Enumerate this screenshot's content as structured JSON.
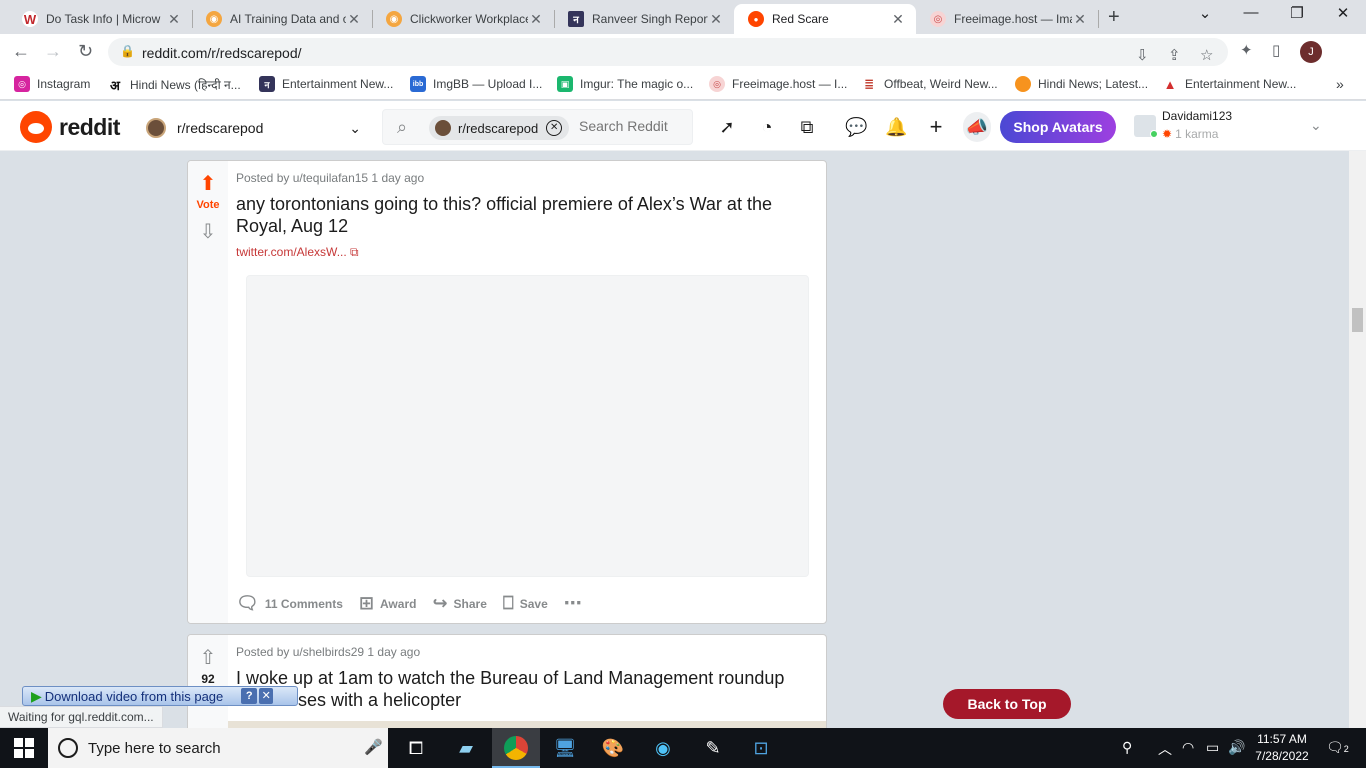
{
  "browser": {
    "tabs": [
      {
        "title": "Do Task Info | Microw",
        "fav": "W",
        "favbg": "#ffffff",
        "favfg": "#c2282d"
      },
      {
        "title": "AI Training Data and o",
        "fav": "◉",
        "favbg": "#f4a640",
        "favfg": "#ffffff"
      },
      {
        "title": "Clickworker Workplace",
        "fav": "◉",
        "favbg": "#f4a640",
        "favfg": "#ffffff"
      },
      {
        "title": "Ranveer Singh Report",
        "fav": "न",
        "favbg": "#34345a",
        "favfg": "#ffffff"
      },
      {
        "title": "Red Scare",
        "fav": "●",
        "favbg": "#ff4500",
        "favfg": "#ffffff"
      },
      {
        "title": "Freeimage.host — Ima",
        "fav": "◎",
        "favbg": "#f7d4d4",
        "favfg": "#c94a4a"
      }
    ],
    "url": "reddit.com/r/redscarepod/",
    "bookmarks": [
      {
        "label": "Instagram",
        "bg": "#d6249f",
        "icon": "◎"
      },
      {
        "label": "Hindi News (हिन्दी न...",
        "bg": "#ffffff",
        "icon": "अ"
      },
      {
        "label": "Entertainment New...",
        "bg": "#34345a",
        "icon": "न"
      },
      {
        "label": "ImgBB — Upload I...",
        "bg": "#2a6ad4",
        "icon": "ibb"
      },
      {
        "label": "Imgur: The magic o...",
        "bg": "#1bb76e",
        "icon": "▣"
      },
      {
        "label": "Freeimage.host — I...",
        "bg": "#f7d4d4",
        "icon": "◎"
      },
      {
        "label": "Offbeat, Weird New...",
        "bg": "#ffffff",
        "icon": "≣"
      },
      {
        "label": "Hindi News; Latest...",
        "bg": "#f7931e",
        "icon": "●"
      },
      {
        "label": "Entertainment New...",
        "bg": "#ffffff",
        "icon": "▲"
      }
    ],
    "status_text": "Waiting for gql.reddit.com...",
    "download_bar": "Download video from this page"
  },
  "reddit": {
    "wordmark": "reddit",
    "community": "r/redscarepod",
    "search_chip": "r/redscarepod",
    "search_placeholder": "Search Reddit",
    "shop_avatars": "Shop Avatars",
    "username": "Davidami123",
    "karma": "1 karma",
    "back_to_top": "Back to Top"
  },
  "posts": [
    {
      "vote_label": "Vote",
      "meta": "Posted by u/tequilafan15 1 day ago",
      "title": "any torontonians going to this? official premiere of Alex’s War at the Royal, Aug 12",
      "link": "twitter.com/AlexsW...",
      "comments": "11 Comments",
      "award": "Award",
      "share": "Share",
      "save": "Save"
    },
    {
      "vote_label": "92",
      "meta": "Posted by u/shelbirds29 1 day ago",
      "title": "I woke up at 1am to watch the Bureau of Land Management roundup wild horses with a helicopter"
    }
  ],
  "taskbar": {
    "search_placeholder": "Type here to search",
    "time": "11:57 AM",
    "date": "7/28/2022",
    "notifications": "2"
  },
  "colors": {
    "reddit_orange": "#ff4500",
    "upvote_active": "#ff4500",
    "back_to_top": "#a5182a",
    "shop_gradient_start": "#4b48d4",
    "shop_gradient_end": "#9d3fe0"
  }
}
